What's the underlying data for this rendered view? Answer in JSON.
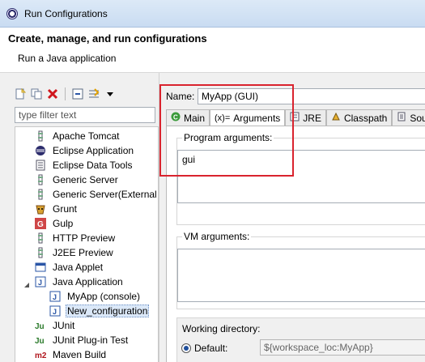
{
  "window": {
    "title": "Run Configurations"
  },
  "header": {
    "title": "Create, manage, and run configurations",
    "subtitle": "Run a Java application"
  },
  "left_panel": {
    "toolbar": [
      "new-launch-config-icon",
      "duplicate-icon",
      "delete-icon",
      "collapse-all-icon",
      "filter-icon",
      "dropdown-arrow-icon"
    ],
    "filter_placeholder": "type filter text",
    "tree": [
      {
        "label": "Apache Tomcat",
        "icon": "tomcat-icon"
      },
      {
        "label": "Eclipse Application",
        "icon": "eclipse-icon"
      },
      {
        "label": "Eclipse Data Tools",
        "icon": "data-tools-icon"
      },
      {
        "label": "Generic Server",
        "icon": "server-icon"
      },
      {
        "label": "Generic Server(External l",
        "icon": "server-icon"
      },
      {
        "label": "Grunt",
        "icon": "grunt-icon"
      },
      {
        "label": "Gulp",
        "icon": "gulp-icon"
      },
      {
        "label": "HTTP Preview",
        "icon": "server-icon"
      },
      {
        "label": "J2EE Preview",
        "icon": "server-icon"
      },
      {
        "label": "Java Applet",
        "icon": "applet-icon"
      },
      {
        "label": "Java Application",
        "icon": "java-app-icon",
        "expanded": true
      },
      {
        "label": "MyApp (console)",
        "icon": "java-config-icon"
      },
      {
        "label": "New_configuration",
        "icon": "java-config-icon",
        "selected": true
      },
      {
        "label": "JUnit",
        "icon": "junit-icon"
      },
      {
        "label": "JUnit Plug-in Test",
        "icon": "junit-icon"
      },
      {
        "label": "Maven Build",
        "icon": "maven-icon"
      }
    ]
  },
  "right_panel": {
    "name_label": "Name:",
    "name_value": "MyApp (GUI)",
    "tabs": [
      {
        "label": "Main",
        "icon": "main-tab-icon"
      },
      {
        "label": "Arguments",
        "icon": "arguments-tab-icon",
        "active": true
      },
      {
        "label": "JRE",
        "icon": "jre-tab-icon"
      },
      {
        "label": "Classpath",
        "icon": "classpath-tab-icon"
      },
      {
        "label": "Sou",
        "icon": "source-tab-icon"
      }
    ],
    "program_arguments": {
      "label": "Program arguments:",
      "value": "gui"
    },
    "vm_arguments": {
      "label": "VM arguments:",
      "value": ""
    },
    "working_directory": {
      "label": "Working directory:",
      "default_label": "Default:",
      "default_value": "${workspace_loc:MyApp}"
    }
  },
  "colors": {
    "highlight": "#d9232e",
    "selection": "#dbe8f8"
  }
}
